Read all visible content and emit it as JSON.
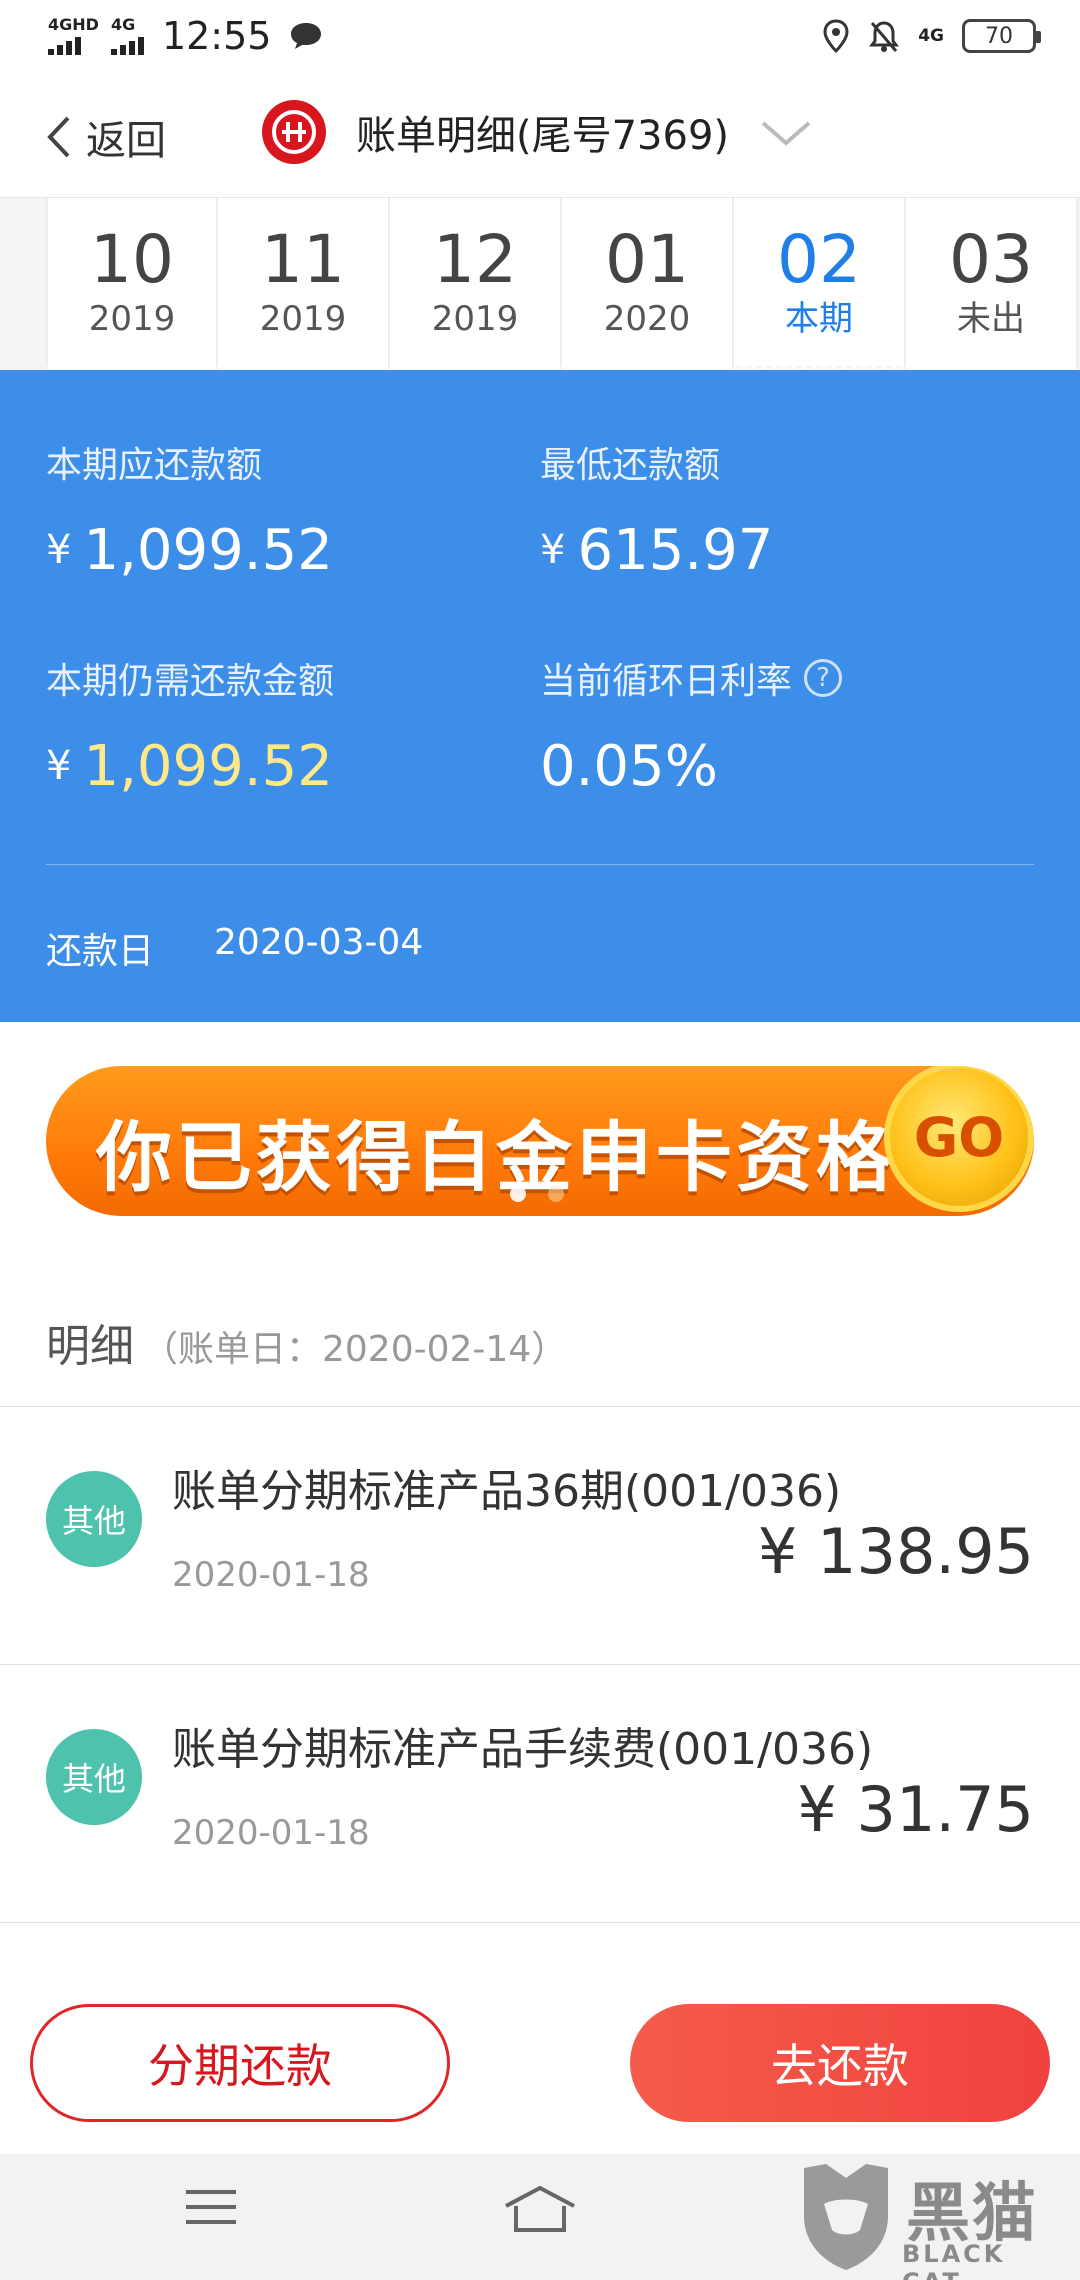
{
  "status_bar": {
    "signal_1": "4GHD",
    "signal_2": "4G",
    "time": "12:55",
    "net_4g": "4G",
    "battery": "70"
  },
  "header": {
    "back_label": "返回",
    "title": "账单明细(尾号7369)"
  },
  "tabs": [
    {
      "month": "10",
      "sub": "2019"
    },
    {
      "month": "11",
      "sub": "2019"
    },
    {
      "month": "12",
      "sub": "2019"
    },
    {
      "month": "01",
      "sub": "2020"
    },
    {
      "month": "02",
      "sub": "本期"
    },
    {
      "month": "03",
      "sub": "未出"
    }
  ],
  "summary": {
    "current_due_label": "本期应还款额",
    "current_due_value": "1,099.52",
    "min_due_label": "最低还款额",
    "min_due_value": "615.97",
    "remaining_label": "本期仍需还款金额",
    "remaining_value": "1,099.52",
    "rate_label": "当前循环日利率",
    "rate_value": "0.05%",
    "due_date_label": "还款日",
    "due_date_value": "2020-03-04",
    "currency": "¥",
    "help": "?"
  },
  "banner": {
    "text": "你已获得白金申卡资格",
    "go": "GO"
  },
  "details": {
    "title": "明细",
    "subtitle": "（账单日：2020-02-14）",
    "items": [
      {
        "badge": "其他",
        "title": "账单分期标准产品36期(001/036)",
        "date": "2020-01-18",
        "amount": "¥ 138.95"
      },
      {
        "badge": "其他",
        "title": "账单分期标准产品手续费(001/036)",
        "date": "2020-01-18",
        "amount": "¥ 31.75"
      }
    ]
  },
  "actions": {
    "installment": "分期还款",
    "repay": "去还款"
  },
  "watermark": {
    "cn": "黑猫",
    "en": "BLACK CAT"
  },
  "colors": {
    "summary_bg": "#3c8ee8",
    "active_tab": "#1f7fe6",
    "accent_red": "#e0262b",
    "badge": "#4fc2ae"
  }
}
